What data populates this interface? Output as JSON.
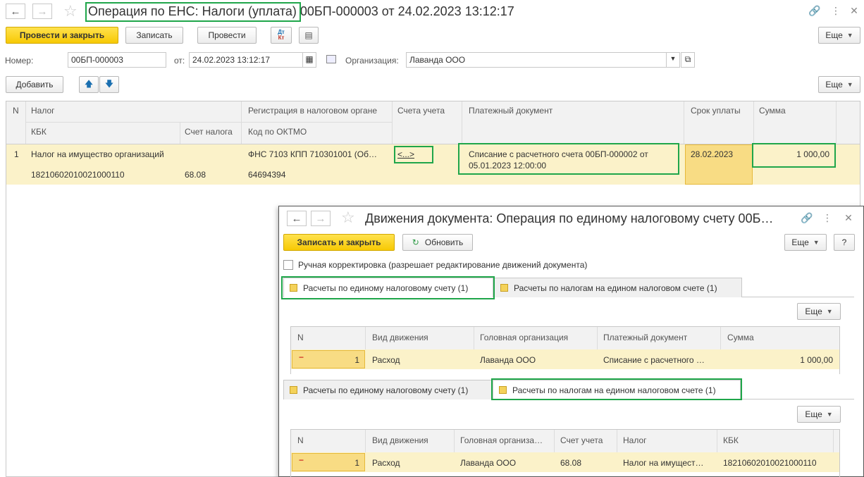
{
  "main": {
    "title": "Операция по ЕНС: Налоги (уплата) 00БП-000003 от 24.02.2023 13:12:17",
    "toolbar": {
      "post_close": "Провести и закрыть",
      "save": "Записать",
      "post": "Провести",
      "dt_kt_top": "Дт",
      "dt_kt_bottom": "Кт",
      "more": "Еще"
    },
    "fields": {
      "number_label": "Номер:",
      "number_value": "00БП-000003",
      "date_label": "от:",
      "date_value": "24.02.2023 13:12:17",
      "org_label": "Организация:",
      "org_value": "Лаванда ООО"
    },
    "table_toolbar": {
      "add": "Добавить",
      "more": "Еще"
    },
    "table": {
      "headers": {
        "n": "N",
        "tax": "Налог",
        "kbk": "КБК",
        "account": "Счет налога",
        "registration": "Регистрация в налоговом органе",
        "oktmo": "Код по ОКТМО",
        "accounts": "Счета учета",
        "payment_doc": "Платежный документ",
        "due": "Срок уплаты",
        "sum": "Сумма"
      },
      "rows": [
        {
          "n": "1",
          "tax": "Налог на имущество организаций",
          "kbk": "18210602010021000110",
          "account": "68.08",
          "registration": "ФНС 7103 КПП 710301001 (Об…",
          "oktmo": "64694394",
          "accounts": "<...>",
          "payment_doc": "Списание с расчетного счета 00БП-000002 от 05.01.2023 12:00:00",
          "due": "28.02.2023",
          "sum": "1 000,00"
        }
      ]
    }
  },
  "dialog": {
    "title": "Движения документа: Операция по единому налоговому счету 00Б…",
    "toolbar": {
      "save_close": "Записать и закрыть",
      "refresh": "Обновить",
      "more": "Еще",
      "help": "?"
    },
    "manual_label": "Ручная корректировка (разрешает редактирование движений документа)",
    "tabs_top": [
      "Расчеты по единому налоговому счету (1)",
      "Расчеты по налогам на едином налоговом счете (1)"
    ],
    "table1": {
      "more": "Еще",
      "headers": [
        "N",
        "Вид движения",
        "Головная организация",
        "Платежный документ",
        "Сумма"
      ],
      "row": {
        "sign": "−",
        "n": "1",
        "kind": "Расход",
        "org": "Лаванда ООО",
        "doc": "Списание с расчетного …",
        "sum": "1 000,00"
      }
    },
    "tabs_bottom": [
      "Расчеты по единому налоговому счету (1)",
      "Расчеты по налогам на едином налоговом счете (1)"
    ],
    "table2": {
      "more": "Еще",
      "headers": [
        "N",
        "Вид движения",
        "Головная организа…",
        "Счет учета",
        "Налог",
        "КБК"
      ],
      "row": {
        "sign": "−",
        "n": "1",
        "kind": "Расход",
        "org": "Лаванда ООО",
        "account": "68.08",
        "tax": "Налог на имущест…",
        "kbk": "18210602010021000110"
      }
    }
  }
}
